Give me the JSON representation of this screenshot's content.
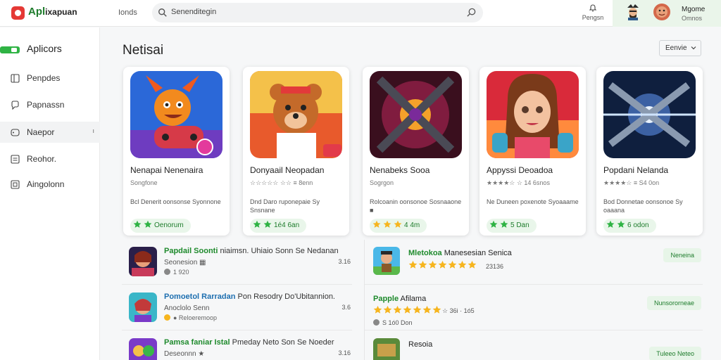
{
  "app": {
    "logo_main": "Apl",
    "logo_rest": "ixapuan"
  },
  "topbar": {
    "link": "Ionds",
    "search_placeholder": "Senenditegin",
    "notify_label": "Pengsn",
    "user_name": "Mgome",
    "user_sub": "Omnos"
  },
  "sidebar": {
    "items": [
      {
        "label": "Aplicors",
        "icon": "apps-icon"
      },
      {
        "label": "Penpdes",
        "icon": "grid-icon"
      },
      {
        "label": "Papnassn",
        "icon": "chat-icon"
      },
      {
        "label": "Naepor",
        "icon": "gamepad-icon",
        "mark": "ı"
      },
      {
        "label": "Reohor.",
        "icon": "list-icon"
      },
      {
        "label": "Aingolonn",
        "icon": "puzzle-icon"
      }
    ]
  },
  "main": {
    "section_title": "Netisai",
    "sort_label": "Eenvie"
  },
  "featured": [
    {
      "title": "Nenapai Nenenaira",
      "sub": "Songfone",
      "desc": "Bcl Denerit oonsonse Syonnone",
      "pill": "Oenorum",
      "colors": [
        "#2b68d8",
        "#f28a1e"
      ]
    },
    {
      "title": "Donyaail Neopadan",
      "sub": "☆☆☆☆☆ ☆☆ ≡ 8enn",
      "desc": "Dnd Daro ruponepaie Sy Snsnane",
      "pill": "1é4 6an",
      "colors": [
        "#e85a2c",
        "#f4c14a"
      ]
    },
    {
      "title": "Nenabeks Sooa",
      "sub": "Sogrgon",
      "desc": "Rolcoanin oonsonoe Sosnaaone ■",
      "pill": "4 4m",
      "colors": [
        "#5a1e2c",
        "#c52a5f"
      ]
    },
    {
      "title": "Appyssi Deoadoa",
      "sub": "★★★★☆ ☆ 14 6snos",
      "desc": "Ne Duneen poxenote Syoaaame",
      "pill": "5 Dan",
      "colors": [
        "#d92a3a",
        "#ff8a3d"
      ]
    },
    {
      "title": "Popdani Nelanda",
      "sub": "★★★★☆ ≡ S4 0on",
      "desc": "Bod Donnetae oonsonoe Sy oaaana",
      "pill": "6 odon",
      "colors": [
        "#143066",
        "#5a8ee8"
      ]
    }
  ],
  "list_left": [
    {
      "title_green": "Papdail Soonti",
      "title_dark": "niaimsn. Uhiaio Sonn Se Nedanan",
      "sub": "Seonesion ▦",
      "meta": "1 920",
      "num": "3.16"
    },
    {
      "title_green": "Pomoetol Rarradan",
      "title_dark": "Pon Resodry Do'Ubitannion.",
      "sub": "Anoclolo   Senn",
      "meta": "● Reloeremoop",
      "num": "3.6"
    },
    {
      "title_green": "Pamsa faniar Istal",
      "title_dark": "Pmeday Neto Son Se Noeder",
      "sub": "Deseonnn ★",
      "meta": "",
      "num": "3.16"
    }
  ],
  "list_right": [
    {
      "title_green": "Mletokoa",
      "title_dark": "Manesesian Senica",
      "meta": "23136",
      "action": "Neneina",
      "stars": 7
    },
    {
      "title_green": "Papple",
      "title_dark": "Afilama",
      "meta": "S 1ó0 Don",
      "extra": "☆ 36i · 1ó5",
      "action": "Nunsororneae",
      "stars": 7
    },
    {
      "title_green": "",
      "title_dark": "Resoia",
      "meta": "",
      "action": "Tuleeo Neteo",
      "stars": 0
    }
  ],
  "colors": {
    "accent_green": "#1e8a2c",
    "star_yellow": "#f6b51e",
    "logo_red": "#e53935"
  }
}
